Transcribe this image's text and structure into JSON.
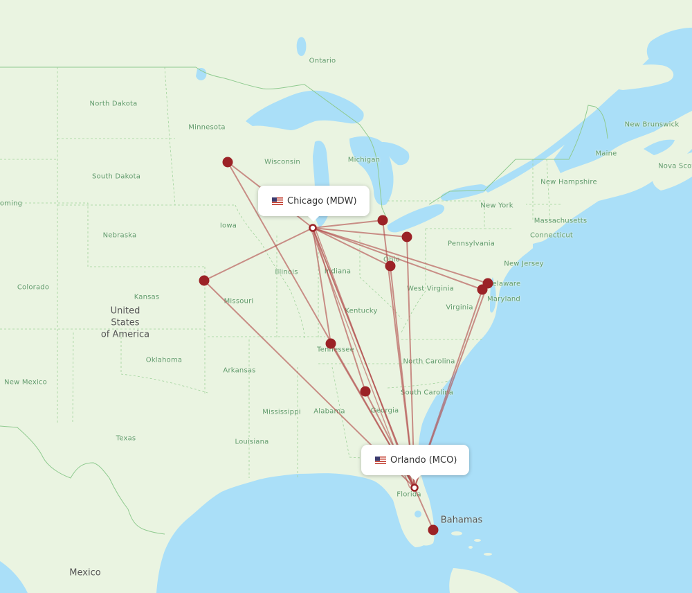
{
  "map": {
    "colors": {
      "water": "#aadff8",
      "land": "#eaf4e1",
      "route": "#b04848",
      "airport_marker": "#9b2226",
      "label": "#5f9a6a",
      "country_label": "#555555"
    },
    "origin": {
      "name": "Chicago (MDW)",
      "city": "Chicago",
      "code": "MDW",
      "flag": "us-flag-icon"
    },
    "destination": {
      "name": "Orlando (MCO)",
      "city": "Orlando",
      "code": "MCO",
      "flag": "us-flag-icon"
    },
    "country_labels": [
      {
        "id": "usa",
        "lines": [
          "United",
          "States",
          "of America"
        ]
      },
      {
        "id": "mexico",
        "lines": [
          "Mexico"
        ]
      },
      {
        "id": "bahamas",
        "lines": [
          "Bahamas"
        ]
      }
    ],
    "region_labels": [
      "Ontario",
      "North Dakota",
      "Minnesota",
      "Wisconsin",
      "Michigan",
      "South Dakota",
      "Wyoming",
      "Iowa",
      "Nebraska",
      "Illinois",
      "Indiana",
      "Ohio",
      "Pennsylvania",
      "New York",
      "New Jersey",
      "Delaware",
      "Maryland",
      "West Virginia",
      "Virginia",
      "Kentucky",
      "Missouri",
      "Kansas",
      "Colorado",
      "Oklahoma",
      "Arkansas",
      "Tennessee",
      "North Carolina",
      "South Carolina",
      "Georgia",
      "Alabama",
      "Mississippi",
      "Louisiana",
      "Texas",
      "New Mexico",
      "Florida",
      "New Hampshire",
      "Massachusetts",
      "Connecticut",
      "Maine",
      "New Brunswick",
      "Nova Scotia"
    ],
    "connected_airports_count": 12
  }
}
